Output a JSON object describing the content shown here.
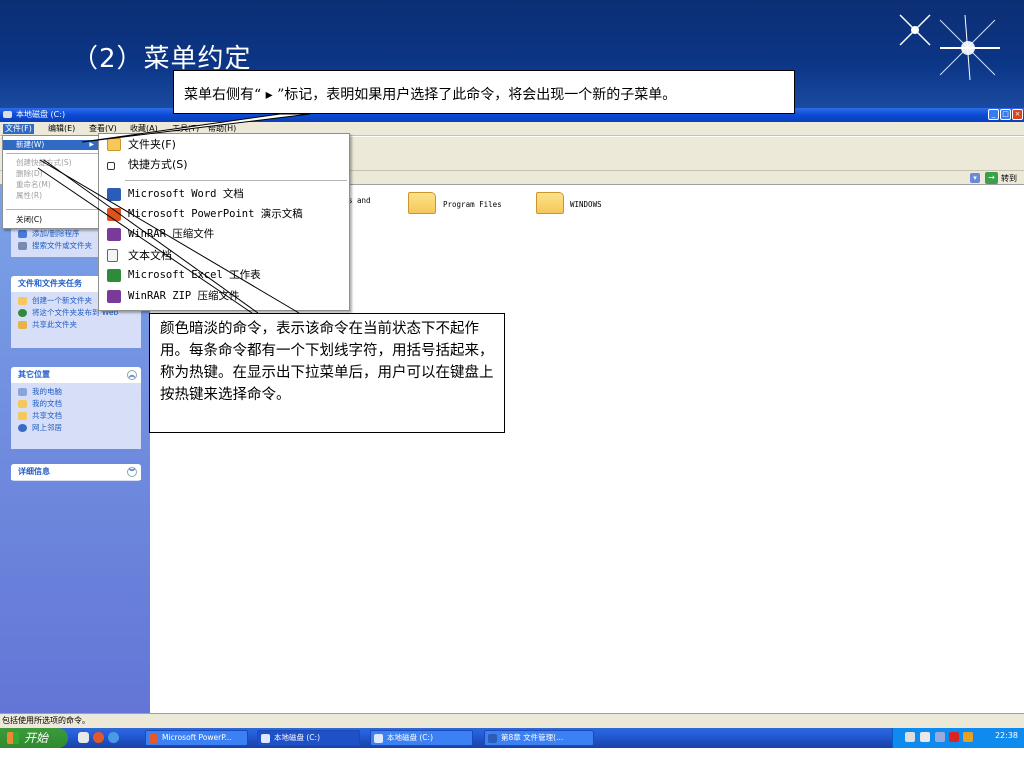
{
  "slide": {
    "title": "（2）菜单约定",
    "callout_top": "菜单右侧有“ ▸ ”标记，表明如果用户选择了此命令，将会出现一个新的子菜单。",
    "callout_bottom": "颜色暗淡的命令，表示该命令在当前状态下不起作用。每条命令都有一个下划线字符，用括号括起来，称为热键。在显示出下拉菜单后，用户可以在键盘上按热键来选择命令。"
  },
  "window": {
    "title": "本地磁盘 (C:)",
    "menubar": [
      "文件(F)",
      "编辑(E)",
      "查看(V)",
      "收藏(A)",
      "工具(T)",
      "帮助(H)"
    ],
    "address_go_label": "转到",
    "status_text": "包括使用所选项的命令。"
  },
  "file_menu": {
    "items": [
      {
        "label": "新建(W)",
        "disabled": false,
        "selected": true,
        "has_submenu": true
      },
      {
        "label": "创建快捷方式(S)",
        "disabled": true
      },
      {
        "label": "删除(D)",
        "disabled": true
      },
      {
        "label": "重命名(M)",
        "disabled": true
      },
      {
        "label": "属性(R)",
        "disabled": true
      },
      {
        "label": "关闭(C)",
        "disabled": false
      }
    ]
  },
  "new_submenu": {
    "items": [
      {
        "label": "文件夹(F)",
        "icon": "folder-icon",
        "color": "#f6c75a"
      },
      {
        "label": "快捷方式(S)",
        "icon": "shortcut-icon",
        "color": "#ffffff"
      },
      {
        "label": "Microsoft Word 文档",
        "icon": "word-icon",
        "color": "#2b5cb8"
      },
      {
        "label": "Microsoft PowerPoint 演示文稿",
        "icon": "powerpoint-icon",
        "color": "#d9541e"
      },
      {
        "label": "WinRAR 压缩文件",
        "icon": "winrar-icon",
        "color": "#7a3a9a"
      },
      {
        "label": "文本文档",
        "icon": "text-document-icon",
        "color": "#e8e8e8"
      },
      {
        "label": "Microsoft Excel 工作表",
        "icon": "excel-icon",
        "color": "#2e8b3a"
      },
      {
        "label": "WinRAR ZIP 压缩文件",
        "icon": "winrar-zip-icon",
        "color": "#7a3a9a"
      }
    ]
  },
  "left_pane": {
    "system_tasks": [
      "添加/删除程序",
      "搜索文件或文件夹"
    ],
    "file_tasks": {
      "title": "文件和文件夹任务",
      "items": [
        "创建一个新文件夹",
        "将这个文件夹发布到 Web",
        "共享此文件夹"
      ]
    },
    "other_places": {
      "title": "其它位置",
      "items": [
        "我的电脑",
        "我的文档",
        "共享文档",
        "网上邻居"
      ]
    },
    "details": {
      "title": "详细信息"
    }
  },
  "files": [
    {
      "name": "s and"
    },
    {
      "name": "Program Files"
    },
    {
      "name": "WINDOWS"
    }
  ],
  "taskbar": {
    "start_label": "开始",
    "tasks": [
      "Microsoft PowerP...",
      "本地磁盘 (C:)",
      "本地磁盘 (C:)",
      "第8章 文件管理(..."
    ],
    "clock": "22:38"
  }
}
